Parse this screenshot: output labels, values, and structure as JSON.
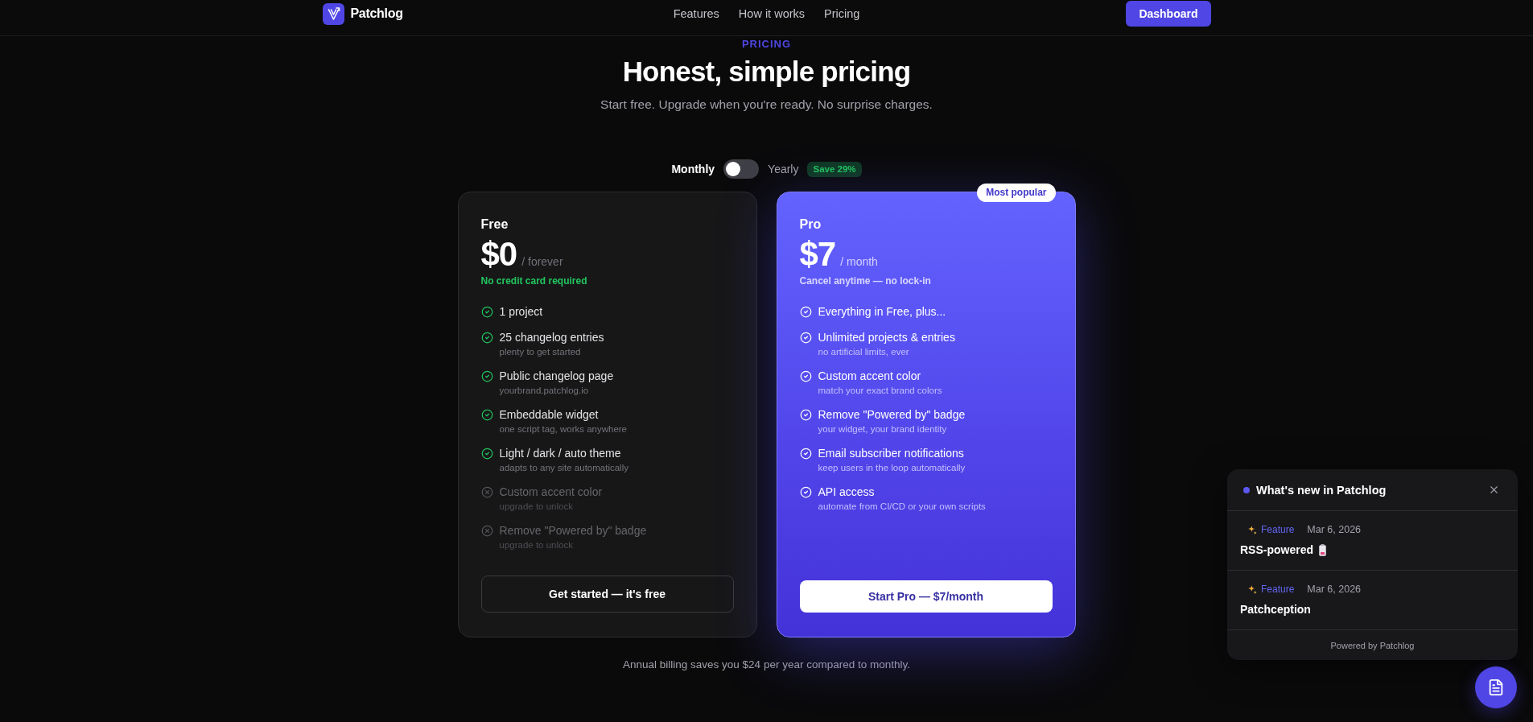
{
  "nav": {
    "brand": "Patchlog",
    "links": [
      {
        "label": "Features"
      },
      {
        "label": "How it works"
      },
      {
        "label": "Pricing"
      }
    ],
    "cta": "Dashboard"
  },
  "hero": {
    "eyebrow": "PRICING",
    "title": "Honest, simple pricing",
    "subtitle": "Start free. Upgrade when you're ready. No surprise charges."
  },
  "billing_toggle": {
    "left_label": "Monthly",
    "right_label": "Yearly",
    "on": false,
    "badge": "Save 29%"
  },
  "plans": [
    {
      "name": "Free",
      "highlighted": false,
      "price": "$0",
      "period": "/ forever",
      "note": "No credit card required",
      "features": [
        {
          "text": "1 project",
          "included": true
        },
        {
          "text": "25 changelog entries",
          "detail": "plenty to get started",
          "included": true
        },
        {
          "text": "Public changelog page",
          "detail": "yourbrand.patchlog.io",
          "included": true
        },
        {
          "text": "Embeddable widget",
          "detail": "one script tag, works anywhere",
          "included": true
        },
        {
          "text": "Light / dark / auto theme",
          "detail": "adapts to any site automatically",
          "included": true
        },
        {
          "text": "Custom accent color",
          "detail": "upgrade to unlock",
          "included": false
        },
        {
          "text": "Remove \"Powered by\" badge",
          "detail": "upgrade to unlock",
          "included": false
        }
      ],
      "button": "Get started — it's free"
    },
    {
      "name": "Pro",
      "highlighted": true,
      "badge": "Most popular",
      "price": "$7",
      "period": "/ month",
      "note": "Cancel anytime — no lock-in",
      "features": [
        {
          "text": "Everything in Free, plus...",
          "included": true
        },
        {
          "text": "Unlimited projects & entries",
          "detail": "no artificial limits, ever",
          "included": true
        },
        {
          "text": "Custom accent color",
          "detail": "match your exact brand colors",
          "included": true
        },
        {
          "text": "Remove \"Powered by\" badge",
          "detail": "your widget, your brand identity",
          "included": true
        },
        {
          "text": "Email subscriber notifications",
          "detail": "keep users in the loop automatically",
          "included": true
        },
        {
          "text": "API access",
          "detail": "automate from CI/CD or your own scripts",
          "included": true
        }
      ],
      "button": "Start Pro — $7/month"
    }
  ],
  "footnote": "Annual billing saves you $24 per year compared to monthly.",
  "widget": {
    "title": "What's new in Patchlog",
    "entries": [
      {
        "kind": "emoji",
        "tag": {
          "label": "Feature",
          "kind": "feature"
        },
        "date": "Mar 6, 2026",
        "title": "RSS-powered"
      },
      {
        "kind": "plain",
        "tag": {
          "label": "Feature",
          "kind": "feature"
        },
        "date": "Mar 6, 2026",
        "title": "Patchception"
      }
    ],
    "footer": "Powered by Patchlog"
  }
}
